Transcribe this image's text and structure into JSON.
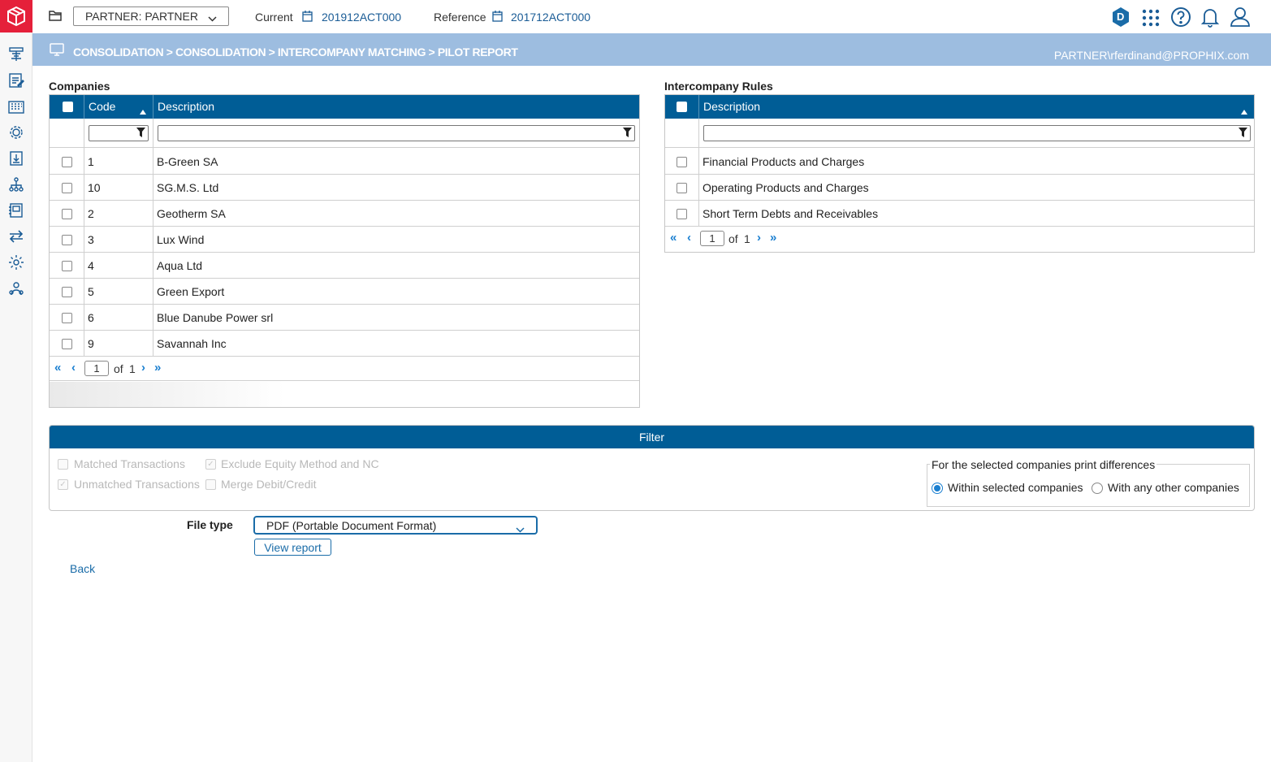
{
  "topbar": {
    "partner_select": "PARTNER: PARTNER",
    "current_label": "Current",
    "current_value": "201912ACT000",
    "reference_label": "Reference",
    "reference_value": "201712ACT000",
    "badge_letter": "D"
  },
  "breadcrumb": "CONSOLIDATION > CONSOLIDATION > INTERCOMPANY MATCHING > PILOT REPORT",
  "user": "PARTNER\\rferdinand@PROPHIX.com",
  "sidebar_icons": [
    "workflow-icon",
    "template-icon",
    "building-grid-icon",
    "gear-network-icon",
    "document-download-icon",
    "hierarchy-icon",
    "notebook-icon",
    "transfer-arrows-icon",
    "settings-cog-icon",
    "user-group-icon"
  ],
  "companies": {
    "title": "Companies",
    "col_code": "Code",
    "col_description": "Description",
    "rows": [
      {
        "code": "1",
        "description": "B-Green SA"
      },
      {
        "code": "10",
        "description": "SG.M.S. Ltd"
      },
      {
        "code": "2",
        "description": "Geotherm SA"
      },
      {
        "code": "3",
        "description": "Lux Wind"
      },
      {
        "code": "4",
        "description": "Aqua Ltd"
      },
      {
        "code": "5",
        "description": "Green Export"
      },
      {
        "code": "6",
        "description": "Blue Danube Power srl"
      },
      {
        "code": "9",
        "description": "Savannah Inc"
      }
    ],
    "page": "1",
    "of_label": "of",
    "total_pages": "1"
  },
  "rules": {
    "title": "Intercompany Rules",
    "col_description": "Description",
    "rows": [
      {
        "description": "Financial Products and Charges"
      },
      {
        "description": "Operating Products and Charges"
      },
      {
        "description": "Short Term Debts and Receivables"
      }
    ],
    "page": "1",
    "of_label": "of",
    "total_pages": "1"
  },
  "filter": {
    "title": "Filter",
    "matched": "Matched Transactions",
    "unmatched": "Unmatched Transactions",
    "exclude_equity": "Exclude Equity Method and NC",
    "merge": "Merge Debit/Credit",
    "diff_legend": "For the selected companies print differences",
    "within": "Within selected companies",
    "any_other": "With any other companies"
  },
  "file_type": {
    "label": "File type",
    "value": "PDF (Portable Document Format)"
  },
  "view_report": "View report",
  "back": "Back",
  "colors": {
    "header": "#005d96",
    "crumbbar": "#9dbde0",
    "logo": "#e5203a",
    "link": "#1a5c96"
  }
}
